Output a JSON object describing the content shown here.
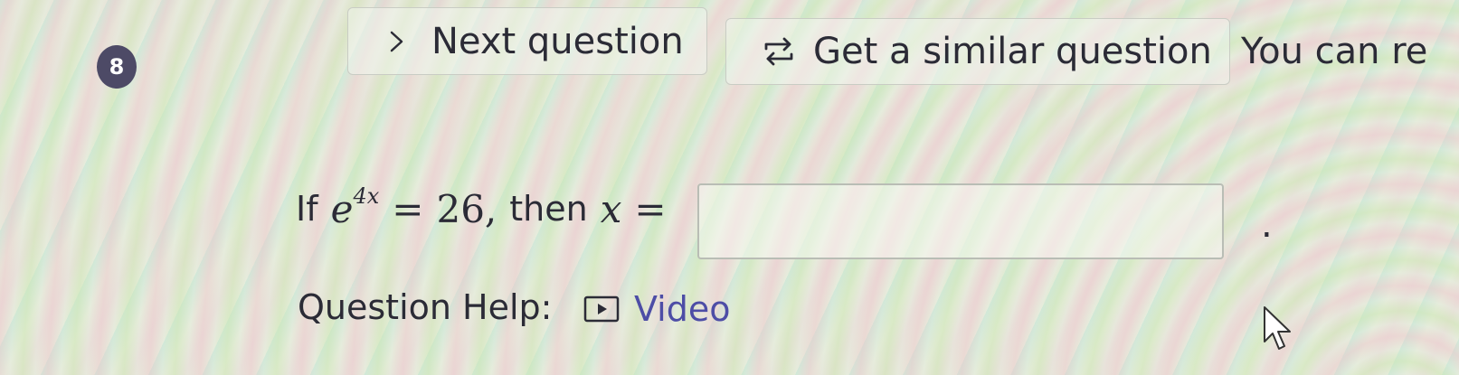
{
  "question_number": "8",
  "toolbar": {
    "next_label": "Next question",
    "similar_label": "Get a similar question",
    "cutoff_text": "You can re"
  },
  "question": {
    "prefix": "If",
    "base": "e",
    "exponent": "4x",
    "equals": "=",
    "value": "26,",
    "then_text": "then",
    "variable": "x",
    "equals2": "=",
    "answer_value": "",
    "period": "."
  },
  "help": {
    "label": "Question Help:",
    "video_label": "Video"
  },
  "colors": {
    "badge": "#4d4a66",
    "link": "#4d4da6",
    "text": "#2b2b36"
  },
  "icons": [
    "chevron-right-icon",
    "repeat-icon",
    "play-icon",
    "mouse-pointer-icon"
  ]
}
